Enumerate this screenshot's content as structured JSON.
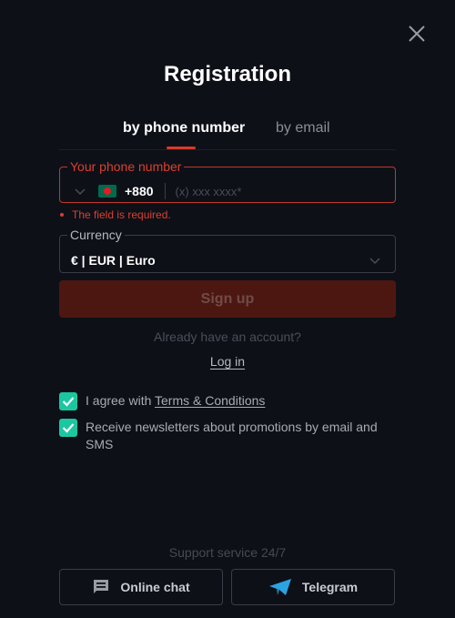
{
  "header": {
    "title": "Registration",
    "close_icon": "close-icon"
  },
  "tabs": [
    {
      "label": "by phone number",
      "active": true
    },
    {
      "label": "by email",
      "active": false
    }
  ],
  "phone_field": {
    "label": "Your phone number",
    "country_flag": "Bangladesh",
    "country_code": "+880",
    "value": "",
    "placeholder": "(x) xxx xxxx*",
    "error": "The field is required."
  },
  "currency_field": {
    "label": "Currency",
    "selected": "€ | EUR | Euro"
  },
  "signup_button": "Sign up",
  "already_account": "Already have an account?",
  "login_link": "Log in",
  "checkboxes": [
    {
      "prefix": "I agree with ",
      "link": "Terms & Conditions",
      "checked": true
    },
    {
      "text": "Receive newsletters about promotions by email and SMS",
      "checked": true
    }
  ],
  "support": {
    "title": "Support service 24/7",
    "buttons": [
      {
        "label": "Online chat",
        "icon": "chat-icon"
      },
      {
        "label": "Telegram",
        "icon": "telegram-icon"
      }
    ]
  },
  "colors": {
    "background": "#0e1018",
    "accent_red": "#d63a2a",
    "checkbox_teal": "#1bc7a1",
    "telegram_blue": "#2aa3e0"
  }
}
